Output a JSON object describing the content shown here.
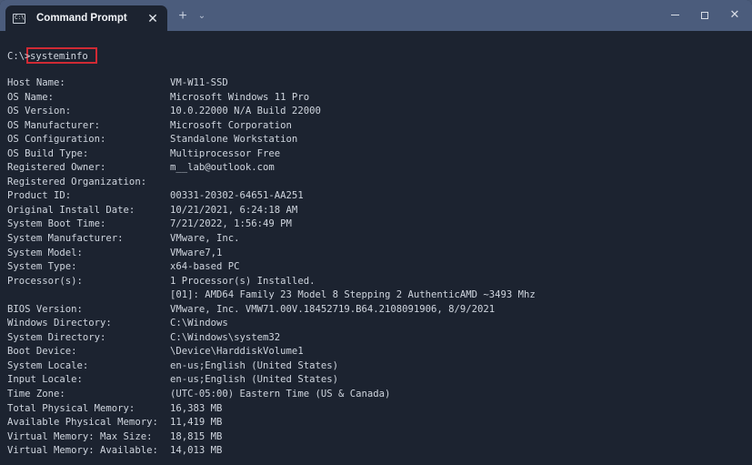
{
  "window": {
    "tab_title": "Command Prompt",
    "icons": {
      "tab": "cmd-icon",
      "tab_close": "close-icon",
      "new_tab": "plus-icon",
      "dropdown": "chevron-down-icon",
      "minimize": "minimize-icon",
      "maximize": "maximize-icon",
      "close": "close-icon"
    },
    "glyphs": {
      "tab_icon": "C:\\",
      "tab_close": "✕",
      "new_tab": "+",
      "dropdown": "⌄",
      "close": "✕"
    }
  },
  "terminal": {
    "prompt": "C:\\",
    "prompt_cursor": ">",
    "command": "systeminfo",
    "highlight_color": "#d02a34",
    "rows": [
      {
        "key": "Host Name:",
        "value": "VM-W11-SSD"
      },
      {
        "key": "OS Name:",
        "value": "Microsoft Windows 11 Pro"
      },
      {
        "key": "OS Version:",
        "value": "10.0.22000 N/A Build 22000"
      },
      {
        "key": "OS Manufacturer:",
        "value": "Microsoft Corporation"
      },
      {
        "key": "OS Configuration:",
        "value": "Standalone Workstation"
      },
      {
        "key": "OS Build Type:",
        "value": "Multiprocessor Free"
      },
      {
        "key": "Registered Owner:",
        "value": "m__lab@outlook.com"
      },
      {
        "key": "Registered Organization:",
        "value": ""
      },
      {
        "key": "Product ID:",
        "value": "00331-20302-64651-AA251"
      },
      {
        "key": "Original Install Date:",
        "value": "10/21/2021, 6:24:18 AM"
      },
      {
        "key": "System Boot Time:",
        "value": "7/21/2022, 1:56:49 PM"
      },
      {
        "key": "System Manufacturer:",
        "value": "VMware, Inc."
      },
      {
        "key": "System Model:",
        "value": "VMware7,1"
      },
      {
        "key": "System Type:",
        "value": "x64-based PC"
      },
      {
        "key": "Processor(s):",
        "value": "1 Processor(s) Installed."
      },
      {
        "key": "",
        "value": "[01]: AMD64 Family 23 Model 8 Stepping 2 AuthenticAMD ~3493 Mhz"
      },
      {
        "key": "BIOS Version:",
        "value": "VMware, Inc. VMW71.00V.18452719.B64.2108091906, 8/9/2021"
      },
      {
        "key": "Windows Directory:",
        "value": "C:\\Windows"
      },
      {
        "key": "System Directory:",
        "value": "C:\\Windows\\system32"
      },
      {
        "key": "Boot Device:",
        "value": "\\Device\\HarddiskVolume1"
      },
      {
        "key": "System Locale:",
        "value": "en-us;English (United States)"
      },
      {
        "key": "Input Locale:",
        "value": "en-us;English (United States)"
      },
      {
        "key": "Time Zone:",
        "value": "(UTC-05:00) Eastern Time (US & Canada)"
      },
      {
        "key": "Total Physical Memory:",
        "value": "16,383 MB"
      },
      {
        "key": "Available Physical Memory:",
        "value": "11,419 MB"
      },
      {
        "key": "Virtual Memory: Max Size:",
        "value": "18,815 MB"
      },
      {
        "key": "Virtual Memory: Available:",
        "value": "14,013 MB"
      }
    ]
  }
}
